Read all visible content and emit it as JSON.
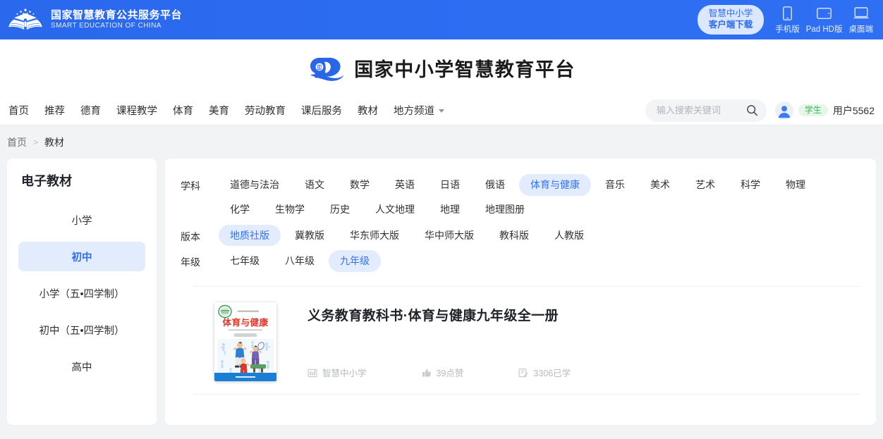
{
  "topbar": {
    "logo_icon": "open-book-logo",
    "brand_cn": "国家智慧教育公共服务平台",
    "brand_en": "SMART EDUCATION OF CHINA",
    "client_pill": {
      "line1": "智慧中小学",
      "line2": "客户端下载"
    },
    "devices": [
      {
        "icon": "phone-icon",
        "label": "手机版"
      },
      {
        "icon": "tablet-icon",
        "label": "Pad HD版"
      },
      {
        "icon": "desktop-icon",
        "label": "桌面端"
      }
    ]
  },
  "subheader": {
    "logo_icon": "cloud-book-logo",
    "title": "国家中小学智慧教育平台"
  },
  "nav": {
    "items": [
      {
        "label": "首页",
        "caret": false
      },
      {
        "label": "推荐",
        "caret": false
      },
      {
        "label": "德育",
        "caret": false
      },
      {
        "label": "课程教学",
        "caret": false
      },
      {
        "label": "体育",
        "caret": false
      },
      {
        "label": "美育",
        "caret": false
      },
      {
        "label": "劳动教育",
        "caret": false
      },
      {
        "label": "课后服务",
        "caret": false
      },
      {
        "label": "教材",
        "caret": false
      },
      {
        "label": "地方频道",
        "caret": true
      }
    ],
    "search": {
      "placeholder": "输入搜索关键词",
      "value": "",
      "icon": "search-icon"
    },
    "user": {
      "avatar_icon": "user-avatar-icon",
      "role_badge": "学生",
      "name": "用户5562"
    }
  },
  "breadcrumb": {
    "home": "首页",
    "separator": ">",
    "current": "教材"
  },
  "sidebar": {
    "title": "电子教材",
    "items": [
      {
        "label": "小学",
        "active": false
      },
      {
        "label": "初中",
        "active": true
      },
      {
        "label": "小学（五•四学制）",
        "active": false
      },
      {
        "label": "初中（五•四学制）",
        "active": false
      },
      {
        "label": "高中",
        "active": false
      }
    ]
  },
  "filters": [
    {
      "label": "学科",
      "options": [
        "道德与法治",
        "语文",
        "数学",
        "英语",
        "日语",
        "俄语",
        "体育与健康",
        "音乐",
        "美术",
        "艺术",
        "科学",
        "物理",
        "化学",
        "生物学",
        "历史",
        "人文地理",
        "地理",
        "地理图册"
      ],
      "selected": "体育与健康"
    },
    {
      "label": "版本",
      "options": [
        "地质社版",
        "冀教版",
        "华东师大版",
        "华中师大版",
        "教科版",
        "人教版"
      ],
      "selected": "地质社版"
    },
    {
      "label": "年级",
      "options": [
        "七年级",
        "八年级",
        "九年级"
      ],
      "selected": "九年级"
    }
  ],
  "results": [
    {
      "cover": {
        "publisher_tag": "义务教育教科书",
        "title": "体育与健康",
        "subtitle": "九年级 全一册",
        "badge": "教育部审定"
      },
      "title": "义务教育教科书·体育与健康九年级全一册",
      "meta": [
        {
          "icon": "publisher-icon",
          "text": "智慧中小学"
        },
        {
          "icon": "thumbs-up-icon",
          "text": "39点赞"
        },
        {
          "icon": "study-icon",
          "text": "3306已学"
        }
      ]
    }
  ],
  "colors": {
    "header_blue": "#2d6df2",
    "accent_blue": "#3274f6",
    "chip_active_bg": "#e3ecfd",
    "badge_green": "#3bb35b",
    "badge_green_bg": "#e6f7ea",
    "page_bg": "#f2f3f5"
  }
}
